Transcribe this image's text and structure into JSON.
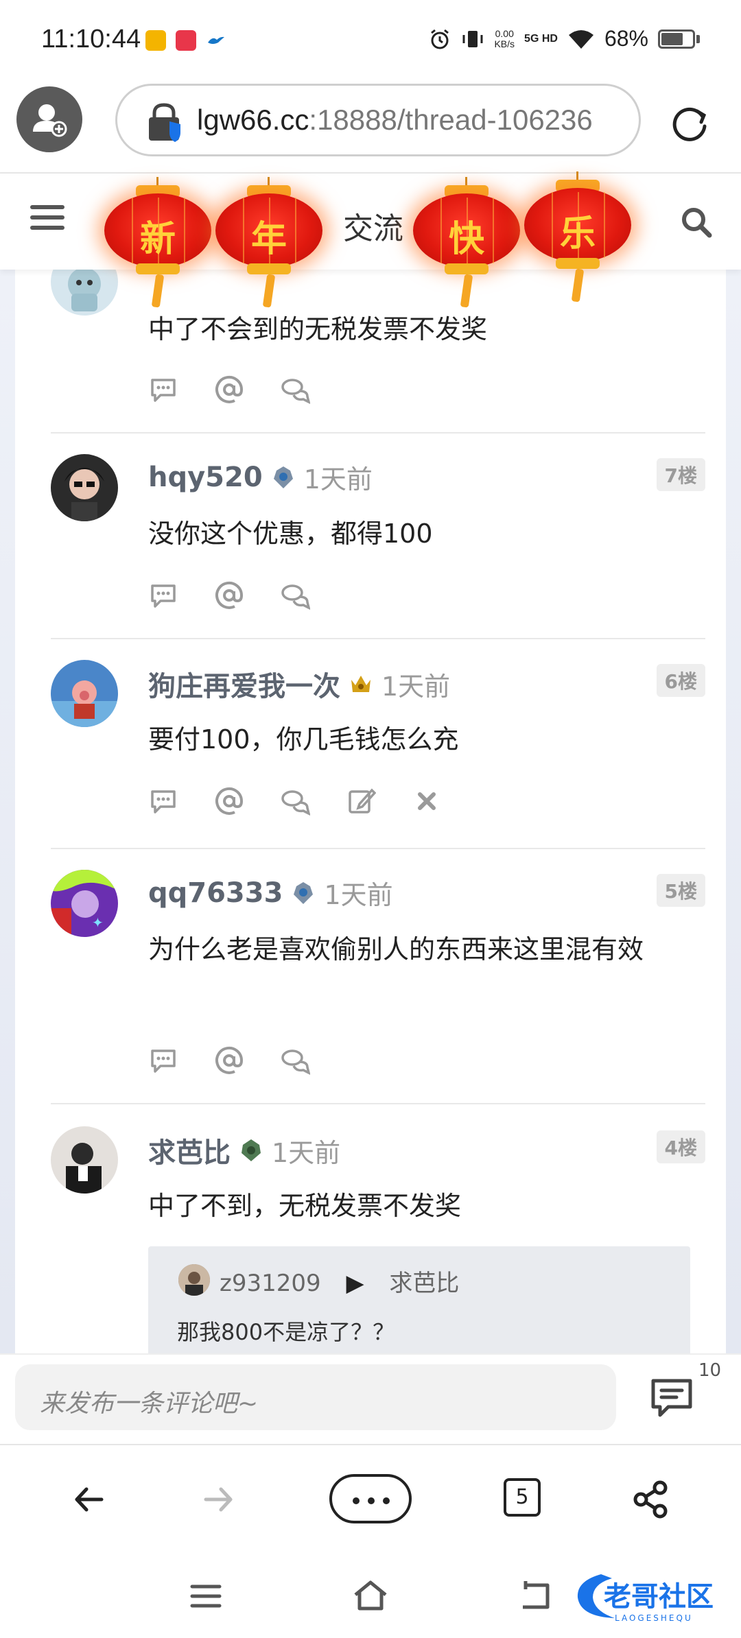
{
  "status_bar": {
    "time": "11:10:44",
    "net_speed_value": "0.00",
    "net_speed_unit": "KB/s",
    "signal": "5G HD",
    "battery_percent": "68%",
    "battery_level": 0.68
  },
  "browser": {
    "url_host": "lgw66.cc",
    "url_rest": ":18888/thread-106236",
    "tab_count": "5"
  },
  "site_header": {
    "title": "交流",
    "lanterns": [
      "新",
      "年",
      "快",
      "乐"
    ]
  },
  "posts": [
    {
      "username": "",
      "time": "",
      "floor": "",
      "text": "中了不会到的无税发票不发奖"
    },
    {
      "username": "hqy520",
      "time": "1天前",
      "floor": "7楼",
      "text": "没你这个优惠，都得100"
    },
    {
      "username": "狗庄再爱我一次",
      "time": "1天前",
      "floor": "6楼",
      "text": "要付100，你几毛钱怎么充"
    },
    {
      "username": "qq76333",
      "time": "1天前",
      "floor": "5楼",
      "text": "为什么老是喜欢偷别人的东西来这里混有效"
    },
    {
      "username": "求芭比",
      "time": "1天前",
      "floor": "4楼",
      "text": "中了不到，无税发票不发奖"
    }
  ],
  "quote": {
    "from": "z931209",
    "to": "求芭比",
    "text": "那我800不是凉了？？"
  },
  "comment_bar": {
    "placeholder": "来发布一条评论吧~",
    "count": "10"
  },
  "watermark": {
    "text": "老哥社区",
    "sub": "LAOGESHEQU"
  },
  "colors": {
    "lantern_red": "#e0190f",
    "lantern_gold": "#f5b323",
    "username": "#5c6470",
    "muted": "#9a9a9a"
  }
}
